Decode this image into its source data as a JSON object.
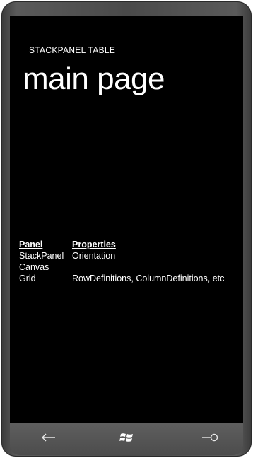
{
  "app": {
    "title": "STACKPANEL TABLE",
    "page_title": "main page"
  },
  "table": {
    "headers": [
      "Panel",
      "Properties"
    ],
    "rows": [
      [
        "StackPanel",
        "Orientation"
      ],
      [
        "Canvas",
        ""
      ],
      [
        "Grid",
        "RowDefinitions, ColumnDefinitions, etc"
      ]
    ]
  },
  "navigation": {
    "back_icon": "back-arrow-icon",
    "start_icon": "windows-logo-icon",
    "search_icon": "search-icon"
  },
  "colors": {
    "screen_background": "#000000",
    "text": "#ffffff",
    "frame": "#4a4a4a",
    "app_bar": "#555555"
  }
}
